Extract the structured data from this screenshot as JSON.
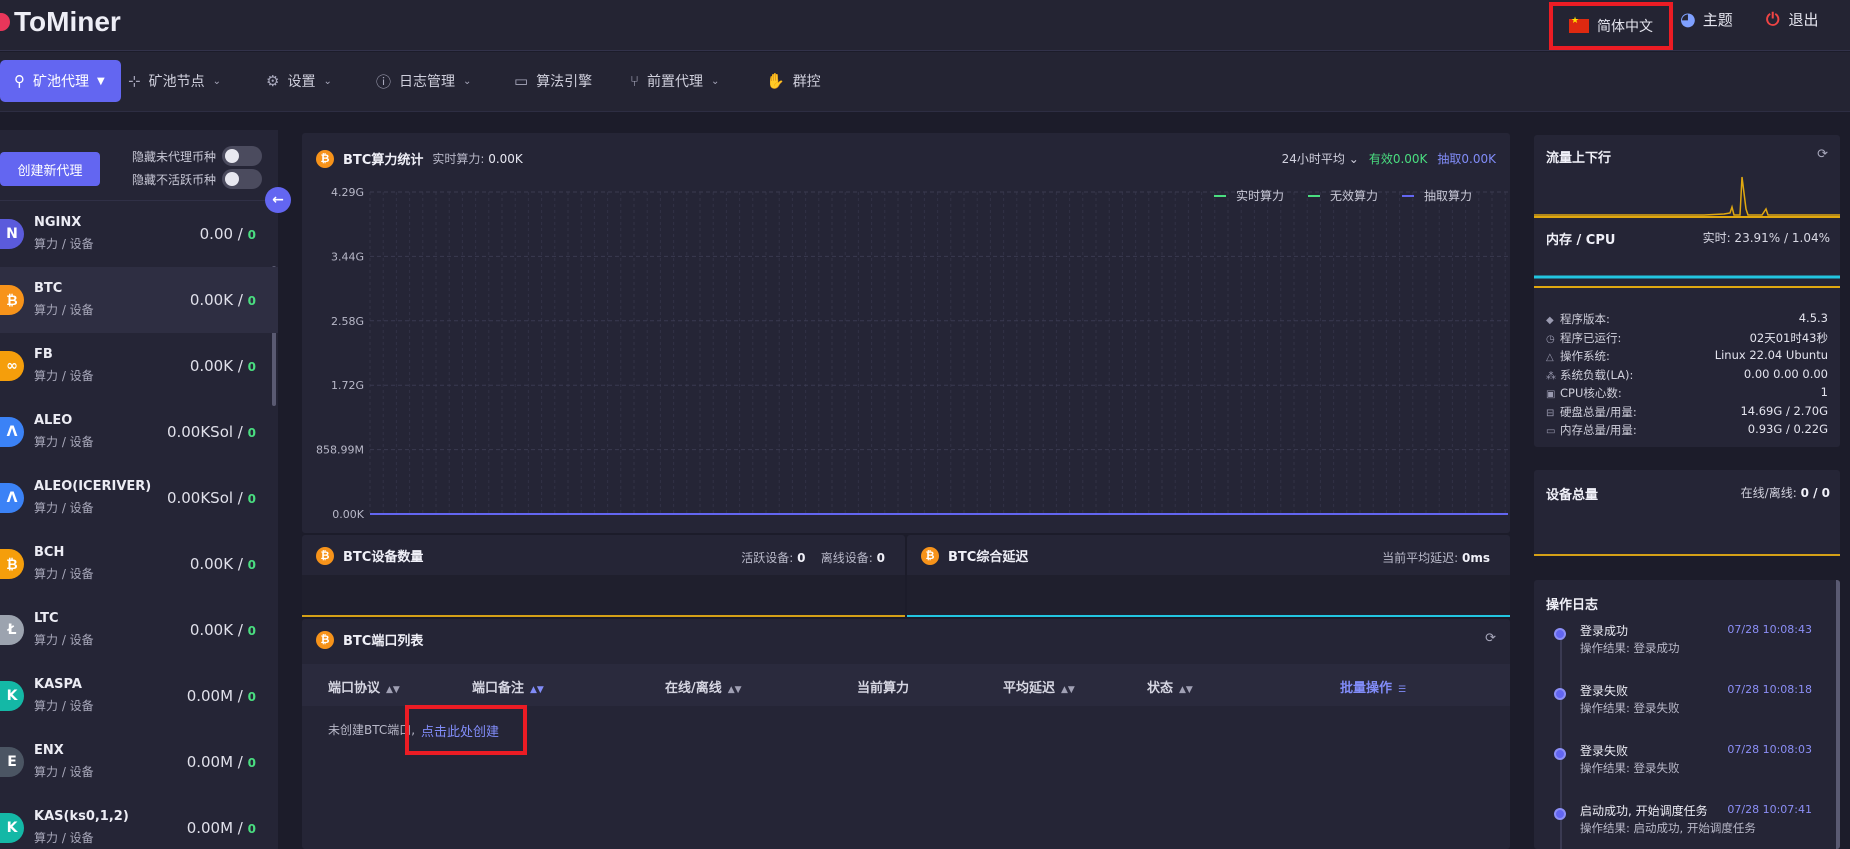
{
  "app": {
    "title": "ToMiner"
  },
  "header": {
    "language": "简体中文",
    "theme": "主题",
    "logout": "退出"
  },
  "nav": [
    {
      "label": "矿池代理",
      "icon": "pool-icon",
      "dropdown": true
    },
    {
      "label": "矿池节点",
      "icon": "nodes-icon",
      "dropdown": true
    },
    {
      "label": "设置",
      "icon": "gear-icon",
      "dropdown": true
    },
    {
      "label": "日志管理",
      "icon": "info-icon",
      "dropdown": true
    },
    {
      "label": "算法引擎",
      "icon": "briefcase-icon",
      "dropdown": false
    },
    {
      "label": "前置代理",
      "icon": "fork-icon",
      "dropdown": true
    },
    {
      "label": "群控",
      "icon": "hand-icon",
      "dropdown": false
    }
  ],
  "sidebar": {
    "create_button": "创建新代理",
    "toggle_hide_unproxied": "隐藏未代理币种",
    "toggle_hide_inactive": "隐藏不活跃币种",
    "coins": [
      {
        "name": "NGINX",
        "sub": "算力 / 设备",
        "value": "0.00 / ",
        "count": "0",
        "color": "#5b5bdc",
        "glyph": "N"
      },
      {
        "name": "BTC",
        "sub": "算力 / 设备",
        "value": "0.00K / ",
        "count": "0",
        "color": "#f7931a",
        "glyph": "₿"
      },
      {
        "name": "FB",
        "sub": "算力 / 设备",
        "value": "0.00K / ",
        "count": "0",
        "color": "#f59e0b",
        "glyph": "∞"
      },
      {
        "name": "ALEO",
        "sub": "算力 / 设备",
        "value": "0.00KSol / ",
        "count": "0",
        "color": "#3b82f6",
        "glyph": "Λ"
      },
      {
        "name": "ALEO(ICERIVER)",
        "sub": "算力 / 设备",
        "value": "0.00KSol / ",
        "count": "0",
        "color": "#3b82f6",
        "glyph": "Λ"
      },
      {
        "name": "BCH",
        "sub": "算力 / 设备",
        "value": "0.00K / ",
        "count": "0",
        "color": "#f59e0b",
        "glyph": "₿"
      },
      {
        "name": "LTC",
        "sub": "算力 / 设备",
        "value": "0.00K / ",
        "count": "0",
        "color": "#9ca3af",
        "glyph": "Ł"
      },
      {
        "name": "KASPA",
        "sub": "算力 / 设备",
        "value": "0.00M / ",
        "count": "0",
        "color": "#14b8a6",
        "glyph": "K"
      },
      {
        "name": "ENX",
        "sub": "算力 / 设备",
        "value": "0.00M / ",
        "count": "0",
        "color": "#4b5563",
        "glyph": "E"
      },
      {
        "name": "KAS(ks0,1,2)",
        "sub": "算力 / 设备",
        "value": "0.00M / ",
        "count": "0",
        "color": "#14b8a6",
        "glyph": "K"
      }
    ]
  },
  "hashrate_card": {
    "title": "BTC算力统计",
    "realtime_label": "实时算力: ",
    "realtime_value": "0.00K",
    "avg_select": "24小时平均",
    "valid": "有效0.00K",
    "extract": "抽取0.00K"
  },
  "chart_data": {
    "type": "line",
    "yticks": [
      "4.29G",
      "3.44G",
      "2.58G",
      "1.72G",
      "858.99M",
      "0.00K"
    ],
    "ylim": [
      0,
      4.29
    ],
    "series": [
      {
        "name": "实时算力",
        "color": "#4ade80",
        "values": [
          0
        ]
      },
      {
        "name": "无效算力",
        "color": "#4ade80",
        "values": [
          0
        ]
      },
      {
        "name": "抽取算力",
        "color": "#6366f1",
        "values": [
          0
        ]
      }
    ],
    "legend_position": "top-right",
    "grid": true
  },
  "device_count_card": {
    "title": "BTC设备数量",
    "active_label": "活跃设备: ",
    "active_value": "0",
    "offline_label": "离线设备: ",
    "offline_value": "0"
  },
  "latency_card": {
    "title": "BTC综合延迟",
    "avg_label": "当前平均延迟: ",
    "avg_value": "0ms"
  },
  "ports_card": {
    "title": "BTC端口列表",
    "columns": [
      "端口协议",
      "端口备注",
      "在线/离线",
      "当前算力",
      "平均延迟",
      "状态",
      "批量操作"
    ],
    "empty_text": "未创建BTC端口,",
    "create_link": "点击此处创建"
  },
  "traffic_card": {
    "title": "流量上下行"
  },
  "cpu_card": {
    "title": "内存 / CPU",
    "realtime": "实时: 23.91% / 1.04%"
  },
  "system_info": [
    {
      "label": "程序版本:",
      "value": "4.5.3",
      "icon": "◆"
    },
    {
      "label": "程序已运行:",
      "value": "02天01时43秒",
      "icon": "◷"
    },
    {
      "label": "操作系统:",
      "value": "Linux 22.04 Ubuntu",
      "icon": "△"
    },
    {
      "label": "系统负载(LA):",
      "value": "0.00 0.00 0.00",
      "icon": "⁂"
    },
    {
      "label": "CPU核心数:",
      "value": "1",
      "icon": "▣"
    },
    {
      "label": "硬盘总量/用量:",
      "value": "14.69G / 2.70G",
      "icon": "⊟"
    },
    {
      "label": "内存总量/用量:",
      "value": "0.93G / 0.22G",
      "icon": "▭"
    }
  ],
  "device_total_card": {
    "title": "设备总量",
    "label": "在线/离线: ",
    "value": "0 / 0"
  },
  "log_card": {
    "title": "操作日志",
    "items": [
      {
        "title": "登录成功",
        "time": "07/28 10:08:43",
        "result": "操作结果: 登录成功"
      },
      {
        "title": "登录失败",
        "time": "07/28 10:08:18",
        "result": "操作结果: 登录失败"
      },
      {
        "title": "登录失败",
        "time": "07/28 10:08:03",
        "result": "操作结果: 登录失败"
      },
      {
        "title": "启动成功, 开始调度任务",
        "time": "07/28 10:07:41",
        "result": "操作结果: 启动成功, 开始调度任务"
      }
    ]
  }
}
